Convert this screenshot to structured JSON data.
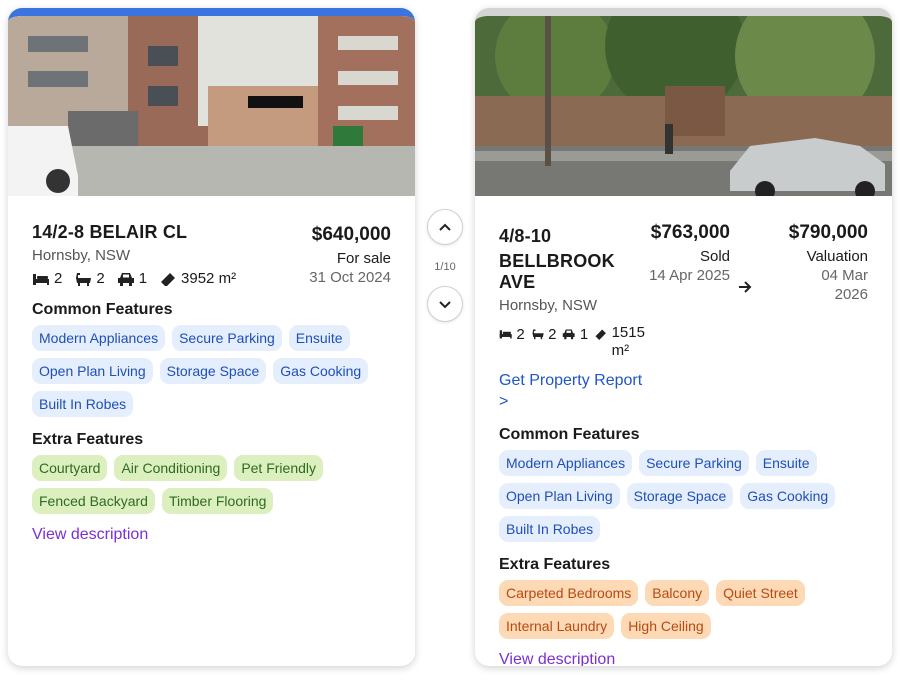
{
  "navigation": {
    "counter": "1/10",
    "prev_icon": "chevron-up-icon",
    "next_icon": "chevron-down-icon"
  },
  "left_card": {
    "accent_color": "#3b73e0",
    "address": "14/2-8 BELAIR CL",
    "suburb": "Hornsby, NSW",
    "beds": "2",
    "baths": "2",
    "cars": "1",
    "area": "3952 m²",
    "price": "$640,000",
    "status": "For sale",
    "date": "31 Oct 2024",
    "common_title": "Common Features",
    "common": [
      "Modern Appliances",
      "Secure Parking",
      "Ensuite",
      "Open Plan Living",
      "Storage Space",
      "Gas Cooking",
      "Built In Robes"
    ],
    "extra_title": "Extra Features",
    "extra": [
      "Courtyard",
      "Air Conditioning",
      "Pet Friendly",
      "Fenced Backyard",
      "Timber Flooring"
    ],
    "view_description": "View description"
  },
  "right_card": {
    "address_line1": "4/8-10",
    "address_line2": "BELLBROOK AVE",
    "suburb": "Hornsby, NSW",
    "beds": "2",
    "baths": "2",
    "cars": "1",
    "area_value": "1515",
    "area_unit": "m²",
    "report_link_line1": "Get Property Report",
    "report_link_line2": ">",
    "sold_price": "$763,000",
    "sold_status": "Sold",
    "sold_date": "14 Apr 2025",
    "valuation_price": "$790,000",
    "valuation_status": "Valuation",
    "valuation_date_line1": "04 Mar",
    "valuation_date_line2": "2026",
    "common_title": "Common Features",
    "common": [
      "Modern Appliances",
      "Secure Parking",
      "Ensuite",
      "Open Plan Living",
      "Storage Space",
      "Gas Cooking",
      "Built In Robes"
    ],
    "extra_title": "Extra Features",
    "extra": [
      "Carpeted Bedrooms",
      "Balcony",
      "Quiet Street",
      "Internal Laundry",
      "High Ceiling"
    ],
    "view_description": "View description"
  },
  "colors": {
    "chip_blue_bg": "#e5eefc",
    "chip_green_bg": "#dcefbf",
    "chip_orange_bg": "#fdd9b5",
    "link_purple": "#7b2fd6",
    "link_blue": "#1f56c9"
  }
}
